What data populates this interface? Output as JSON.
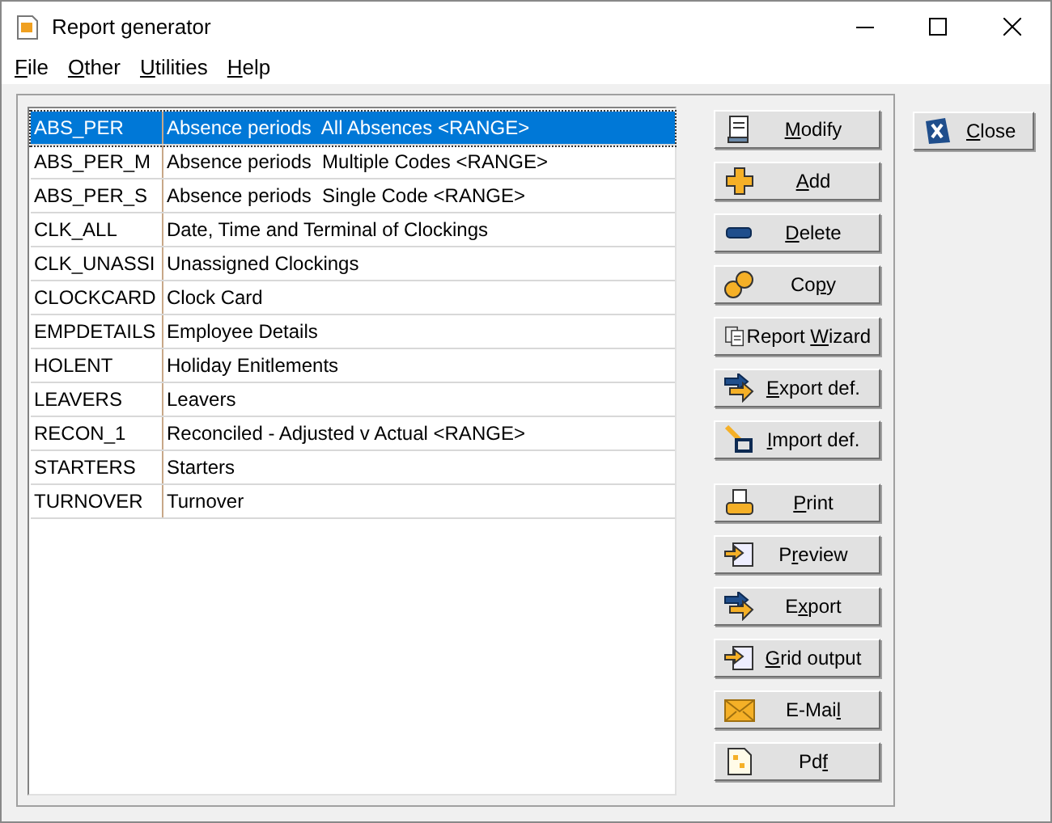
{
  "window": {
    "title": "Report generator"
  },
  "menu": [
    {
      "key": "F",
      "after": "ile"
    },
    {
      "key": "O",
      "after": "ther"
    },
    {
      "key": "U",
      "after": "tilities"
    },
    {
      "key": "H",
      "after": "elp"
    }
  ],
  "reports": [
    {
      "code": "ABS_PER",
      "description": "Absence periods  All Absences <RANGE>",
      "selected": true
    },
    {
      "code": "ABS_PER_M",
      "description": "Absence periods  Multiple Codes <RANGE>",
      "selected": false
    },
    {
      "code": "ABS_PER_S",
      "description": "Absence periods  Single Code <RANGE>",
      "selected": false
    },
    {
      "code": "CLK_ALL",
      "description": "Date, Time and Terminal of Clockings",
      "selected": false
    },
    {
      "code": "CLK_UNASSI",
      "description": "Unassigned Clockings",
      "selected": false
    },
    {
      "code": "CLOCKCARD",
      "description": "Clock Card",
      "selected": false
    },
    {
      "code": "EMPDETAILS",
      "description": "Employee Details",
      "selected": false
    },
    {
      "code": "HOLENT",
      "description": "Holiday Enitlements",
      "selected": false
    },
    {
      "code": "LEAVERS",
      "description": "Leavers",
      "selected": false
    },
    {
      "code": "RECON_1",
      "description": "Reconciled - Adjusted v Actual <RANGE>",
      "selected": false
    },
    {
      "code": "STARTERS",
      "description": "Starters",
      "selected": false
    },
    {
      "code": "TURNOVER",
      "description": "Turnover",
      "selected": false
    }
  ],
  "edit_buttons": [
    {
      "key": "M",
      "after": "odify"
    },
    {
      "key": "A",
      "after": "dd"
    },
    {
      "key": "D",
      "after": "elete"
    },
    {
      "before": "Co",
      "key": "p",
      "after": "y"
    },
    {
      "before": "Report ",
      "key": "W",
      "after": "izard"
    },
    {
      "key": "E",
      "after": "xport def."
    },
    {
      "key": "I",
      "after": "mport def."
    }
  ],
  "output_buttons": [
    {
      "key": "P",
      "after": "rint"
    },
    {
      "before": "P",
      "key": "r",
      "after": "eview"
    },
    {
      "before": "E",
      "key": "x",
      "after": "port"
    },
    {
      "key": "G",
      "after": "rid output"
    },
    {
      "before": "E-Mai",
      "key": "l"
    },
    {
      "before": "Pd",
      "key": "f"
    }
  ],
  "close_button": {
    "key": "C",
    "after": "lose"
  }
}
